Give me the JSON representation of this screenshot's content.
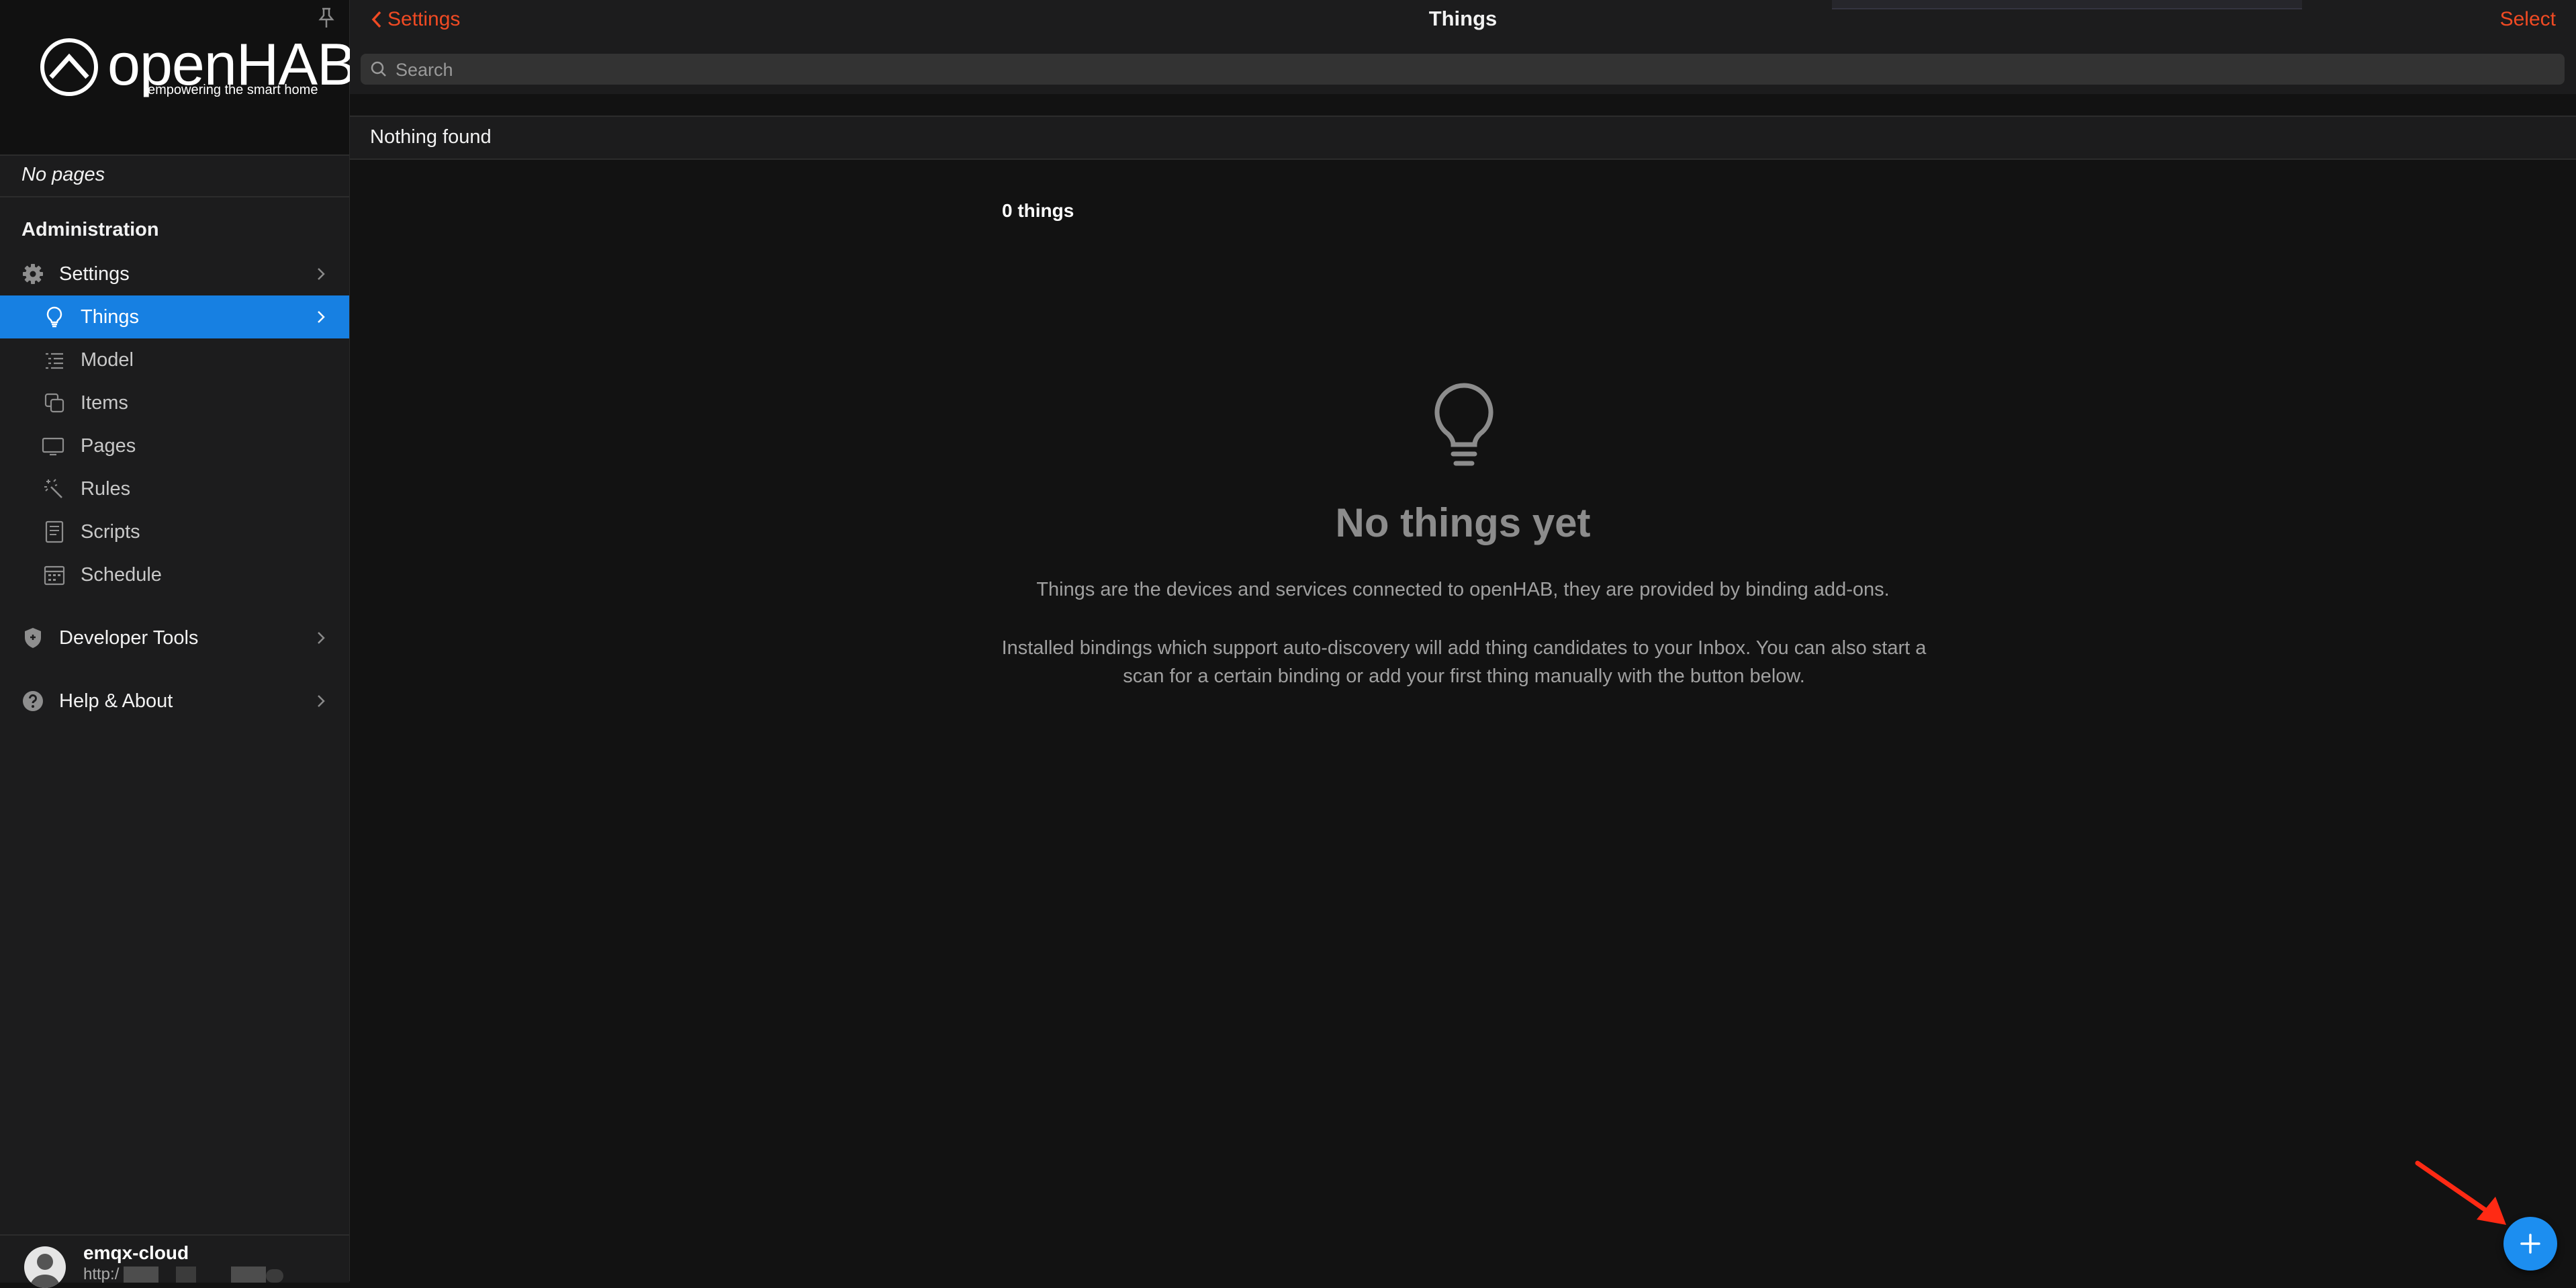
{
  "sidebar": {
    "logo": {
      "word": "openHAB",
      "tagline": "empowering the smart home"
    },
    "no_pages": "No pages",
    "admin_title": "Administration",
    "items": [
      {
        "label": "Settings",
        "icon": "gear-icon",
        "active": false
      },
      {
        "label": "Things",
        "icon": "lightbulb-icon",
        "active": true
      },
      {
        "label": "Model",
        "icon": "list-tree-icon"
      },
      {
        "label": "Items",
        "icon": "copy-squares-icon"
      },
      {
        "label": "Pages",
        "icon": "display-icon"
      },
      {
        "label": "Rules",
        "icon": "wand-icon"
      },
      {
        "label": "Scripts",
        "icon": "document-icon"
      },
      {
        "label": "Schedule",
        "icon": "calendar-icon"
      }
    ],
    "developer_tools": "Developer Tools",
    "help_about": "Help & About",
    "user": {
      "name": "emqx-cloud",
      "url": "http:/"
    }
  },
  "topbar": {
    "back_label": "Settings",
    "title": "Things",
    "select_label": "Select"
  },
  "search": {
    "placeholder": "Search",
    "value": ""
  },
  "results": {
    "nothing_found": "Nothing found",
    "count": "0 things"
  },
  "empty_state": {
    "title": "No things yet",
    "desc1": "Things are the devices and services connected to openHAB, they are provided by binding add-ons.",
    "desc2": "Installed bindings which support auto-discovery will add thing candidates to your Inbox. You can also start a scan for a certain binding or add your first thing manually with the button below."
  },
  "colors": {
    "accent": "#f04a23",
    "active": "#1780e2",
    "fab": "#1c8ef0",
    "annotation": "#ff2a14"
  }
}
